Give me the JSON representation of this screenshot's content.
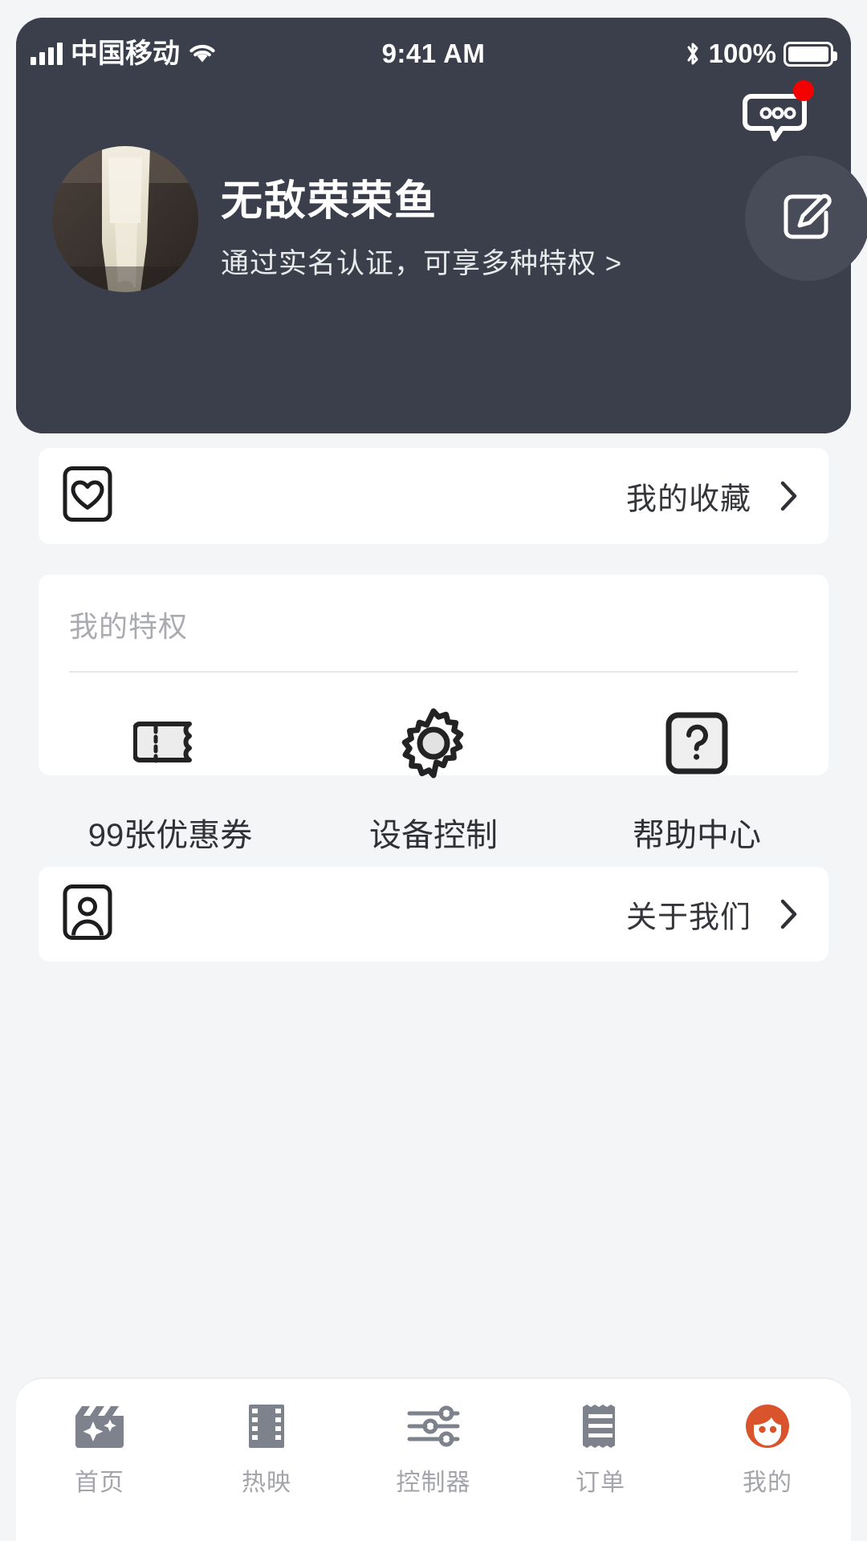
{
  "status_bar": {
    "carrier": "中国移动",
    "time": "9:41 AM",
    "battery_percent": "100%",
    "signal_icon": "signal-bars-icon",
    "wifi_icon": "wifi-icon",
    "bluetooth_icon": "bluetooth-icon",
    "battery_icon": "battery-full-icon"
  },
  "header": {
    "message_icon": "message-bubble-icon",
    "message_badge": "",
    "avatar_alt": "user-avatar-photo",
    "username": "无敌荣荣鱼",
    "verify_text": "通过实名认证，可享多种特权 >",
    "edit_icon": "edit-pencil-icon",
    "bg_color": "#3a3f4b",
    "edit_btn_color": "#474c58",
    "badge_color": "#f50000"
  },
  "favorites_card": {
    "icon": "heart-in-box-icon",
    "label": "我的收藏",
    "chevron": "chevron-right-icon"
  },
  "privileges_card": {
    "title": "我的特权",
    "items": [
      {
        "icon": "coupon-ticket-icon",
        "label": "99张优惠券"
      },
      {
        "icon": "gear-icon",
        "label": "设备控制"
      },
      {
        "icon": "question-mark-box-icon",
        "label": "帮助中心"
      }
    ]
  },
  "about_card": {
    "icon": "person-in-box-icon",
    "label": "关于我们",
    "chevron": "chevron-right-icon"
  },
  "bottom_nav": {
    "active_index": 4,
    "active_color": "#d9532c",
    "inactive_color": "#7d828d",
    "label_color": "#a3a5ab",
    "items": [
      {
        "icon": "clapperboard-sparkle-icon",
        "label": "首页"
      },
      {
        "icon": "film-strip-icon",
        "label": "热映"
      },
      {
        "icon": "sliders-icon",
        "label": "控制器"
      },
      {
        "icon": "receipt-icon",
        "label": "订单"
      },
      {
        "icon": "face-avatar-icon",
        "label": "我的"
      }
    ]
  }
}
